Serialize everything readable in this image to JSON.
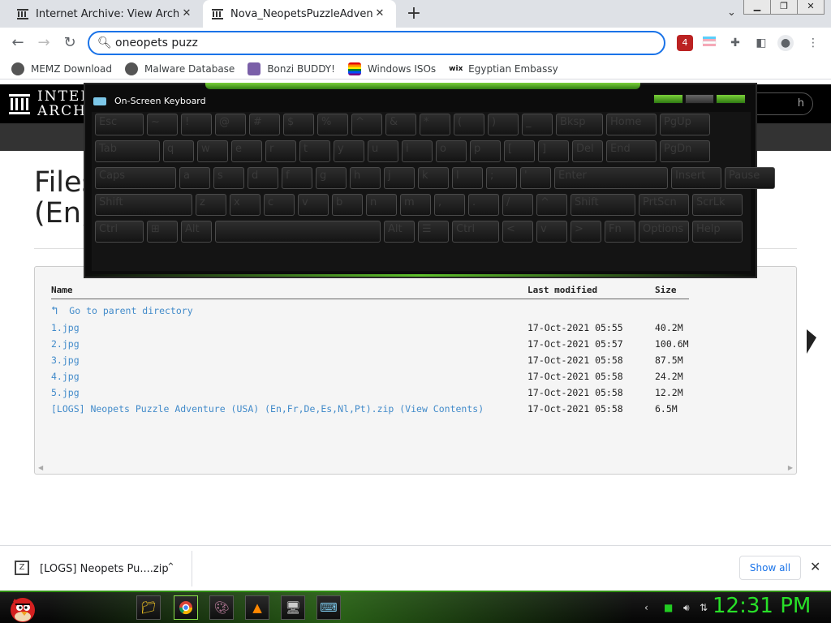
{
  "browser": {
    "tabs": [
      {
        "title": "Internet Archive: View Archive",
        "icon": "archive-icon",
        "active": false
      },
      {
        "title": "Nova_NeopetsPuzzleAdventure_",
        "icon": "archive-icon",
        "active": true
      }
    ],
    "new_tab": "+",
    "address": "oneopets puzz",
    "extension_badge": "4"
  },
  "bookmarks": [
    {
      "label": "MEMZ Download",
      "icon": "globe-icon"
    },
    {
      "label": "Malware Database",
      "icon": "globe-icon"
    },
    {
      "label": "Bonzi BUDDY!",
      "icon": "bonzi-icon"
    },
    {
      "label": "Windows ISOs",
      "icon": "rainbow-flag-icon"
    },
    {
      "label": "Egyptian Embassy",
      "icon": "wix-icon"
    }
  ],
  "ia": {
    "logo_line1": "INTER",
    "logo_line2": "ARCHI",
    "search_fragment": "h",
    "page_title_line1": "Files",
    "page_title_line2": "(En,"
  },
  "listing": {
    "headers": {
      "name": "Name",
      "modified": "Last modified",
      "size": "Size"
    },
    "parent": "Go to parent directory",
    "rows": [
      {
        "name": "1.jpg",
        "modified": "17-Oct-2021 05:55",
        "size": "40.2M"
      },
      {
        "name": "2.jpg",
        "modified": "17-Oct-2021 05:57",
        "size": "100.6M"
      },
      {
        "name": "3.jpg",
        "modified": "17-Oct-2021 05:58",
        "size": "87.5M"
      },
      {
        "name": "4.jpg",
        "modified": "17-Oct-2021 05:58",
        "size": "24.2M"
      },
      {
        "name": "5.jpg",
        "modified": "17-Oct-2021 05:58",
        "size": "12.2M"
      },
      {
        "name": "[LOGS] Neopets Puzzle Adventure (USA) (En,Fr,De,Es,Nl,Pt).zip (View Contents)",
        "modified": "17-Oct-2021 05:58",
        "size": "6.5M"
      }
    ]
  },
  "osk": {
    "title": "On-Screen Keyboard",
    "rows": [
      [
        "Esc",
        "~",
        "!",
        "@",
        "#",
        "$",
        "%",
        "^",
        "&",
        "*",
        "(",
        ")",
        "_",
        "Bksp",
        "Home",
        "PgUp"
      ],
      [
        "Tab",
        "q",
        "w",
        "e",
        "r",
        "t",
        "y",
        "u",
        "i",
        "o",
        "p",
        "[",
        "]",
        "Del",
        "End",
        "PgDn"
      ],
      [
        "Caps",
        "a",
        "s",
        "d",
        "f",
        "g",
        "h",
        "j",
        "k",
        "l",
        ";",
        "'",
        "Enter",
        "Insert",
        "Pause"
      ],
      [
        "Shift",
        "z",
        "x",
        "c",
        "v",
        "b",
        "n",
        "m",
        ",",
        ".",
        "/",
        "^",
        "Shift",
        "PrtScn",
        "ScrLk"
      ],
      [
        "Ctrl",
        "⊞",
        "Alt",
        "",
        "Alt",
        "☰",
        "Ctrl",
        "<",
        "v",
        ">",
        "Fn",
        "Options",
        "Help"
      ]
    ]
  },
  "download": {
    "filename": "[LOGS] Neopets Pu....zip",
    "show_all": "Show all"
  },
  "taskbar": {
    "clock": "12:31 PM"
  }
}
